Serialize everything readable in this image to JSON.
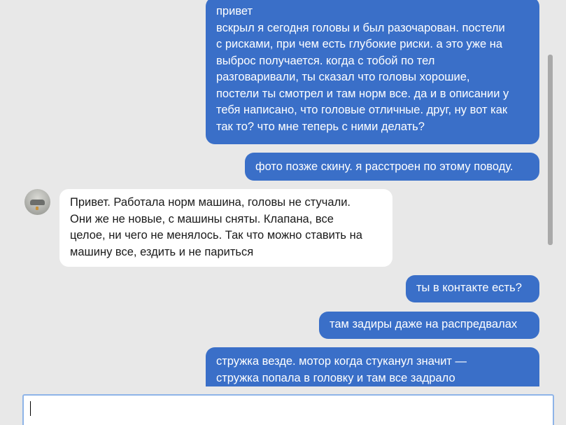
{
  "conversation": {
    "messages": [
      {
        "direction": "outgoing",
        "text": "привет\nвскрыл я сегодня головы и был разочарован. постели\nс рисками, при чем есть глубокие риски. а это уже на\nвыброс получается. когда с тобой по тел\nразговаривали, ты сказал что головы хорошие,\nпостели ты смотрел и там норм все. да и в описании у\nтебя написано, что головые отличные. друг, ну вот как\nтак то? что мне теперь с ними делать?"
      },
      {
        "direction": "outgoing",
        "text": "фото позже скину. я расстроен по этому поводу."
      },
      {
        "direction": "incoming",
        "text": "Привет. Работала норм машина, головы не стучали.\nОни же не новые, с машины сняты. Клапана, все\nцелое, ни чего не менялось. Так что можно ставить на\nмашину все, ездить и не париться"
      },
      {
        "direction": "outgoing",
        "text": "ты в контакте есть?"
      },
      {
        "direction": "outgoing",
        "text": "там задиры даже на распредвалах"
      },
      {
        "direction": "outgoing",
        "text": "стружка везде. мотор когда стуканул значит —\nстружка попала в головку и там все задрало"
      }
    ]
  },
  "composer": {
    "value": "",
    "placeholder": ""
  },
  "colors": {
    "outgoing_bubble": "#3a6fc8",
    "incoming_bubble": "#ffffff",
    "background": "#e8e8e8",
    "composer_border": "#8eb4e8"
  }
}
